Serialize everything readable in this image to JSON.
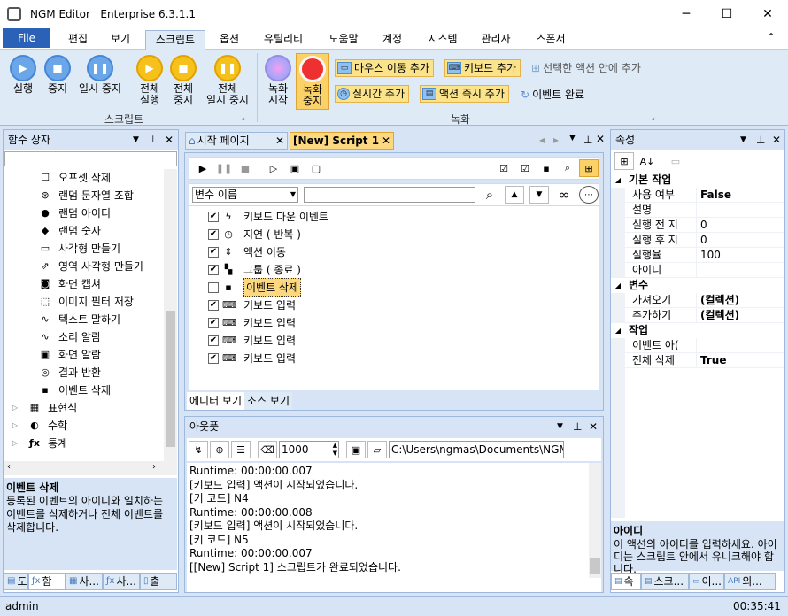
{
  "window": {
    "app_name": "NGM Editor",
    "edition": "Enterprise 6.3.1.1",
    "minimize": "─",
    "maximize": "☐",
    "close": "✕"
  },
  "ribbon_tabs": {
    "file": "File",
    "items": [
      "편집",
      "보기",
      "스크립트",
      "옵션",
      "유틸리티",
      "도움말",
      "계정",
      "시스템",
      "관리자",
      "스폰서"
    ],
    "active": "스크립트",
    "collapse": "⌃"
  },
  "ribbon": {
    "script_group": {
      "name": "스크립트",
      "run": "실행",
      "stop": "중지",
      "pause": "일시 중지",
      "run_all": [
        "전체",
        "실행"
      ],
      "stop_all": [
        "전체",
        "중지"
      ],
      "pause_all": [
        "전체",
        "일시 중지"
      ]
    },
    "record_group": {
      "name": "녹화",
      "record_start": [
        "녹화",
        "시작"
      ],
      "record_stop": [
        "녹화",
        "중지"
      ],
      "add_mouse_move": "마우스 이동 추가",
      "add_keyboard": "키보드 추가",
      "add_in_selected": "선택한 액션 안에 추가",
      "add_realtime": "실시간 추가",
      "add_action_immediately": "액션 즉시 추가",
      "event_done": "이벤트 완료"
    }
  },
  "left_panel": {
    "title": "함수 상자",
    "items": [
      {
        "label": "오프셋 삭제",
        "icon": "offset-delete-icon",
        "glyph": "☐"
      },
      {
        "label": "랜덤 문자열 조합",
        "icon": "share-icon",
        "glyph": "⊛"
      },
      {
        "label": "랜덤 아이디",
        "icon": "share-filled-icon",
        "glyph": "●"
      },
      {
        "label": "랜덤 숫자",
        "icon": "share-filled-icon",
        "glyph": "◆"
      },
      {
        "label": "사각형 만들기",
        "icon": "rectangle-icon",
        "glyph": "▭"
      },
      {
        "label": "영역 사각형 만들기",
        "icon": "region-rectangle-icon",
        "glyph": "⇗"
      },
      {
        "label": "화면 캡쳐",
        "icon": "camera-icon",
        "glyph": "◙"
      },
      {
        "label": "이미지 필터 저장",
        "icon": "image-filter-icon",
        "glyph": "⬚"
      },
      {
        "label": "텍스트 말하기",
        "icon": "wave-icon",
        "glyph": "∿"
      },
      {
        "label": "소리 알람",
        "icon": "wave-icon",
        "glyph": "∿"
      },
      {
        "label": "화면 알람",
        "icon": "screen-alarm-icon",
        "glyph": "▣"
      },
      {
        "label": "결과 반환",
        "icon": "target-icon",
        "glyph": "◎"
      },
      {
        "label": "이벤트 삭제",
        "icon": "trash-icon",
        "glyph": "▪"
      }
    ],
    "groups": [
      {
        "label": "표현식",
        "glyph": "▦"
      },
      {
        "label": "수학",
        "glyph": "◐"
      },
      {
        "label": "통계",
        "glyph": "ƒx"
      }
    ],
    "desc_title": "이벤트 삭제",
    "desc_text": "등록된 이벤트의 아이디와 일치하는 이벤트를 삭제하거나 전체 이벤트를 삭제합니다.",
    "bottom_tabs": [
      "도",
      "함",
      "사...",
      "사...",
      "출"
    ]
  },
  "doc_tabs": [
    {
      "label": "시작 페이지"
    },
    {
      "label": "[New] Script 1"
    }
  ],
  "editor": {
    "var_select": "변수 이름",
    "search_value": "",
    "actions": [
      {
        "label": "키보드 다운 이벤트",
        "checked": true,
        "glyph": "ϟ"
      },
      {
        "label": "지연 ( 반복 )",
        "checked": true,
        "glyph": "◷"
      },
      {
        "label": "액션 이동",
        "checked": true,
        "glyph": "⇕"
      },
      {
        "label": "그룹 ( 종료 )",
        "checked": true,
        "glyph": "▚"
      },
      {
        "label": "이벤트 삭제",
        "checked": false,
        "glyph": "▪"
      },
      {
        "label": "키보드 입력",
        "checked": true,
        "glyph": "⌨"
      },
      {
        "label": "키보드 입력",
        "checked": true,
        "glyph": "⌨"
      },
      {
        "label": "키보드 입력",
        "checked": true,
        "glyph": "⌨"
      },
      {
        "label": "키보드 입력",
        "checked": true,
        "glyph": "⌨"
      }
    ],
    "bottom_tabs": [
      "에디터 보기",
      "소스 보기"
    ]
  },
  "output": {
    "title": "아웃풋",
    "interval": "1000",
    "path": "C:\\Users\\ngmas\\Documents\\NGM6\\",
    "lines": [
      "Runtime: 00:00:00.007",
      "[키보드 입력] 액션이 시작되었습니다.",
      "[키 코드] N4",
      "Runtime: 00:00:00.008",
      "[키보드 입력] 액션이 시작되었습니다.",
      "[키 코드] N5",
      "Runtime: 00:00:00.007",
      "[[New] Script 1] 스크립트가 완료되었습니다."
    ]
  },
  "properties": {
    "title": "속성",
    "categories": [
      {
        "name": "기본 작업",
        "rows": [
          {
            "name": "사용 여부",
            "value": "False",
            "bold": true
          },
          {
            "name": "설명",
            "value": ""
          },
          {
            "name": "실행 전 지",
            "value": "0"
          },
          {
            "name": "실행 후 지",
            "value": "0"
          },
          {
            "name": "실행율",
            "value": "100"
          },
          {
            "name": "아이디",
            "value": ""
          }
        ]
      },
      {
        "name": "변수",
        "rows": [
          {
            "name": "가져오기",
            "value": "(컬렉션)",
            "bold": true
          },
          {
            "name": "추가하기",
            "value": "(컬렉션)",
            "bold": true
          }
        ]
      },
      {
        "name": "작업",
        "rows": [
          {
            "name": "이벤트 아(",
            "value": ""
          },
          {
            "name": "전체 삭제",
            "value": "True",
            "bold": true
          }
        ]
      }
    ],
    "desc_title": "아이디",
    "desc_text": "이 액션의 아이디를 입력하세요. 아이디는 스크립트 안에서 유니크해야 합니다.",
    "bottom_tabs": [
      "속",
      "스크...",
      "이...",
      "외..."
    ]
  },
  "status": {
    "user": "admin",
    "time": "00:35:41"
  }
}
